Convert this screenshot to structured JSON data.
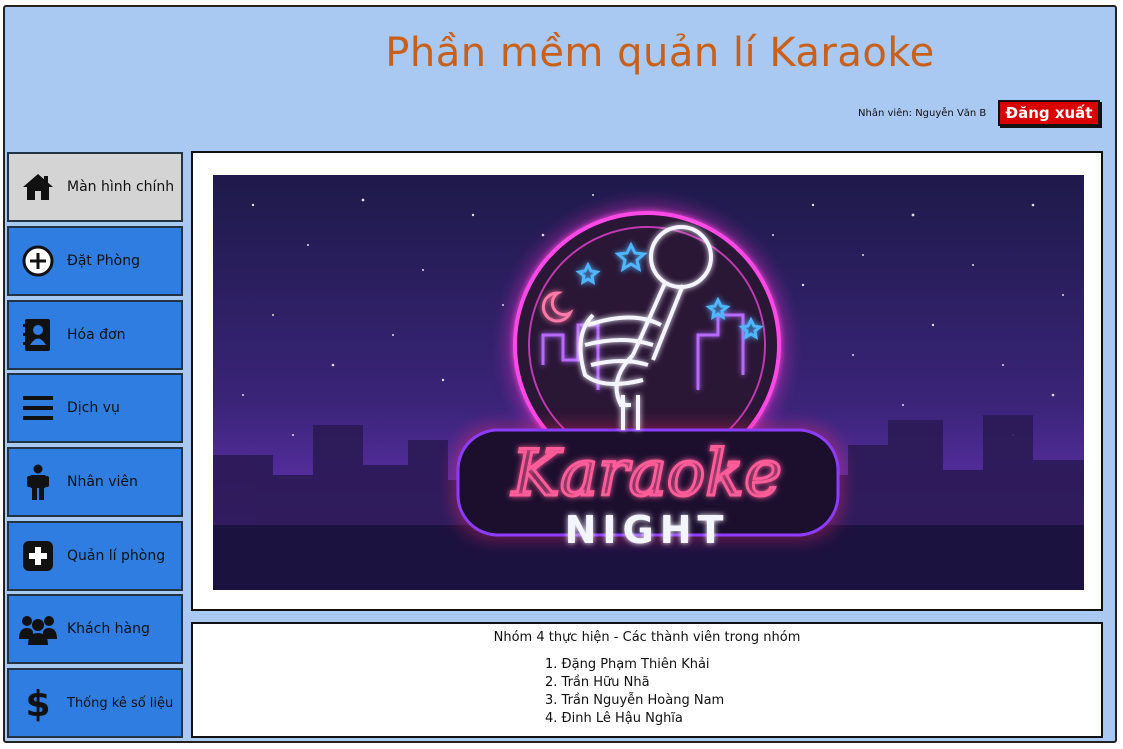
{
  "app": {
    "title": "Phần mềm quản lí Karaoke",
    "employee_label": "Nhân viên: Nguyễn Văn B",
    "logout_label": "Đăng xuất"
  },
  "sidebar": {
    "items": [
      {
        "label": "Màn hình chính",
        "icon": "home-icon",
        "active": true
      },
      {
        "label": "Đặt Phòng",
        "icon": "plus-circle-icon"
      },
      {
        "label": "Hóa đơn",
        "icon": "contact-book-icon"
      },
      {
        "label": "Dịch vụ",
        "icon": "menu-icon"
      },
      {
        "label": "Nhân viên",
        "icon": "person-icon"
      },
      {
        "label": "Quản lí phòng",
        "icon": "plus-square-icon"
      },
      {
        "label": "Khách hàng",
        "icon": "users-icon"
      },
      {
        "label": "Thống kê số liệu",
        "icon": "dollar-icon"
      }
    ]
  },
  "banner": {
    "line1": "Karaoke",
    "line2": "NIGHT"
  },
  "info": {
    "title": "Nhóm 4 thực hiện - Các thành viên trong nhóm",
    "members": [
      "1. Đặng Phạm Thiên Khải",
      "2. Trần Hữu Nhã",
      "3. Trần Nguyễn Hoàng Nam",
      "4. Đinh Lê Hậu Nghĩa"
    ]
  },
  "colors": {
    "background": "#a9c8f2",
    "title": "#c8601a",
    "menu": "#2f7de1",
    "menu_active": "#d4d4d4",
    "logout": "#d90000"
  }
}
